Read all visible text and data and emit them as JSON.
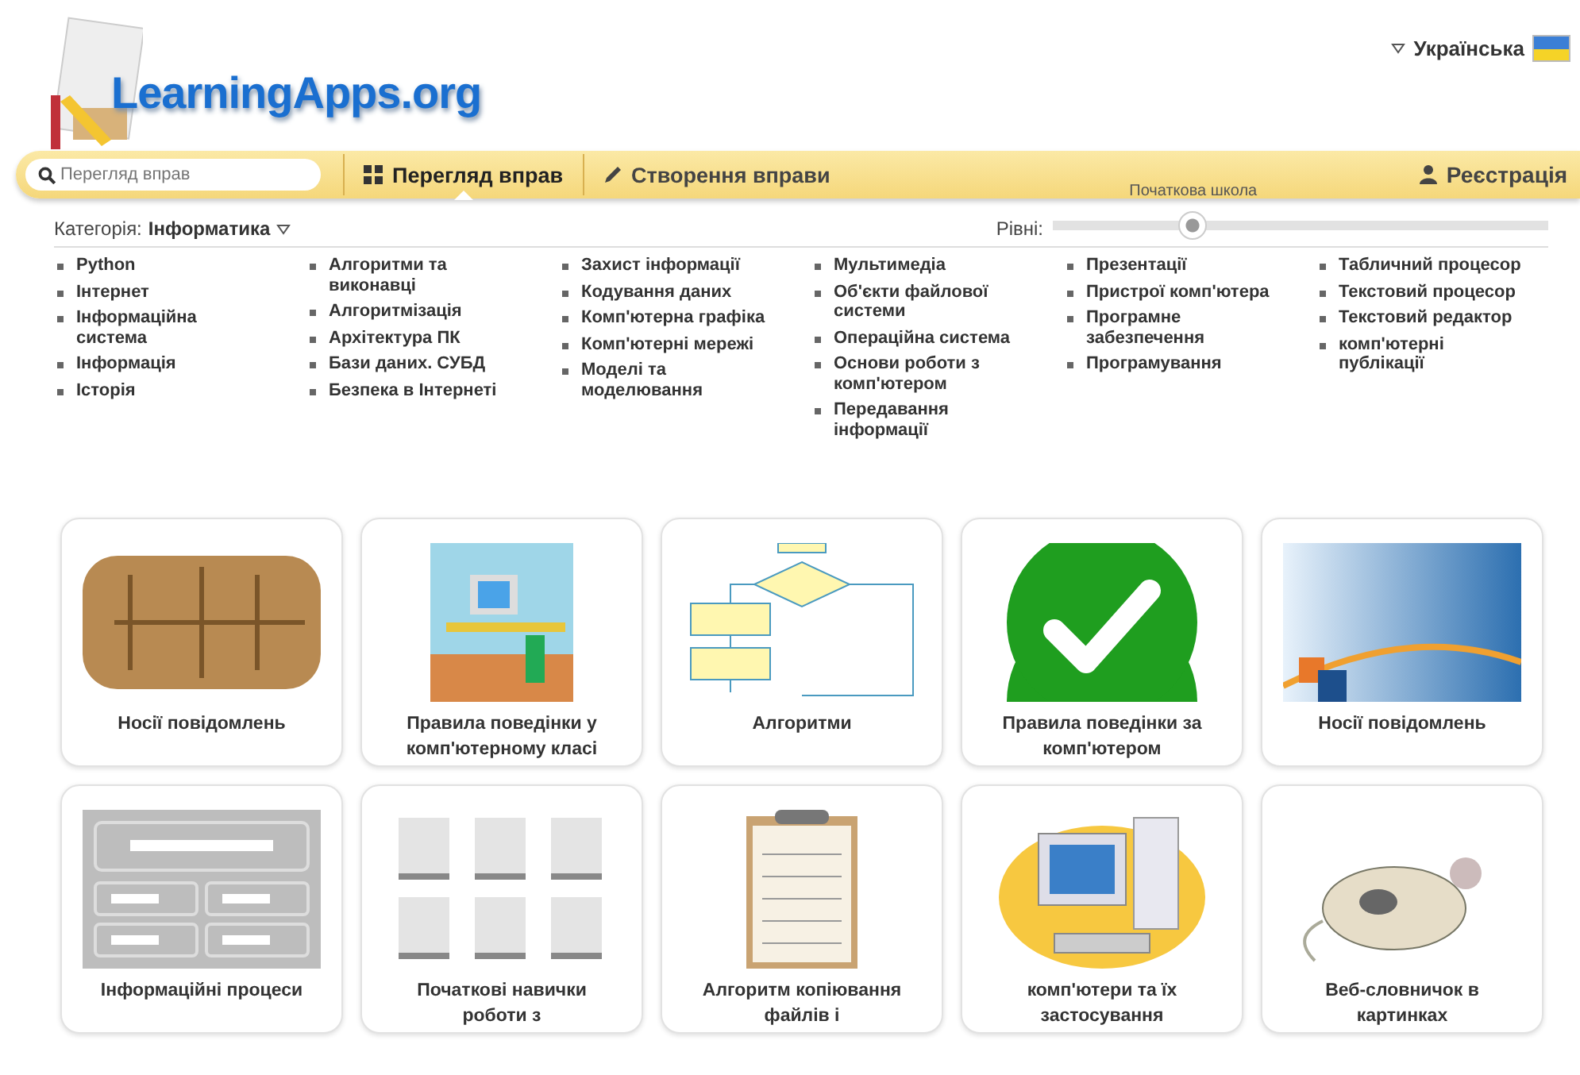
{
  "language": {
    "label": "Українська"
  },
  "logo": {
    "text": "LearningApps.org"
  },
  "nav": {
    "search": {
      "placeholder": "Перегляд вправ"
    },
    "items": [
      {
        "label": "Перегляд вправ",
        "kind": "grid",
        "selected": true
      },
      {
        "label": "Створення вправи",
        "kind": "pencil",
        "selected": false
      }
    ],
    "register": {
      "label": "Реєстрація"
    }
  },
  "filter": {
    "category_label": "Категорія:",
    "category": "Інформатика",
    "levels_label": "Рівні:",
    "level_caption": "Початкова школа",
    "level": 0.27
  },
  "topics": [
    [
      "Python",
      "Інтернет",
      "Інформаційна система",
      "Інформація",
      "Історія"
    ],
    [
      "Алгоритми та виконавці",
      "Алгоритмізація",
      "Архітектура ПК",
      "Бази даних. СУБД",
      "Безпека в Інтернеті"
    ],
    [
      "Захист інформації",
      "Кодування даних",
      "Комп'ютерна графіка",
      "Комп'ютерні мережі",
      "Моделі та моделювання"
    ],
    [
      "Мультимедіа",
      "Об'єкти файлової системи",
      "Операційна система",
      "Основи роботи з комп'ютером",
      "Передавання інформації"
    ],
    [
      "Презентації",
      "Пристрої комп'ютера",
      "Програмне забезпечення",
      "Програмування"
    ],
    [
      "Табличний процесор",
      "Текстовий процесор",
      "Текстовий редактор",
      "комп'ютерні публікації"
    ]
  ],
  "cards": [
    {
      "title": "Носії повідомлень",
      "kind": "tablet"
    },
    {
      "title": "Правила поведінки у комп'ютерному класі",
      "kind": "desk"
    },
    {
      "title": "Алгоритми",
      "kind": "flowchart"
    },
    {
      "title": "Правила поведінки за комп'ютером",
      "kind": "check"
    },
    {
      "title": "Носії повідомлень",
      "kind": "abstract"
    },
    {
      "title": "Інформаційні процеси",
      "kind": "wireframe"
    },
    {
      "title": "Початкові навички роботи з",
      "kind": "tiles"
    },
    {
      "title": "Алгоритм копіювання файлів і",
      "kind": "clipboard"
    },
    {
      "title": "комп'ютери та їх застосування",
      "kind": "computer"
    },
    {
      "title": "Веб-словничок в картинках",
      "kind": "mouse"
    }
  ]
}
